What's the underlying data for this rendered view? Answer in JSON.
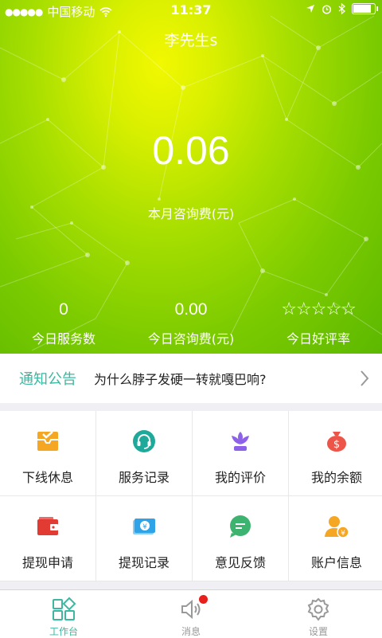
{
  "status_bar": {
    "signal": "●●●●●",
    "carrier": "中国移动",
    "time": "11:37"
  },
  "header": {
    "username": "李先生s"
  },
  "summary": {
    "amount": "0.06",
    "amount_label": "本月咨询费(元)"
  },
  "stats": [
    {
      "value": "0",
      "label": "今日服务数"
    },
    {
      "value": "0.00",
      "label": "今日咨询费(元)"
    },
    {
      "stars": "☆☆☆☆☆",
      "label": "今日好评率"
    }
  ],
  "notice": {
    "tag": "通知公告",
    "text": "为什么脖子发硬一转就嘎巴响?"
  },
  "menu": [
    {
      "label": "下线休息",
      "icon": "offline-rest-icon",
      "color": "#f5a623"
    },
    {
      "label": "服务记录",
      "icon": "headset-icon",
      "color": "#1fa99a"
    },
    {
      "label": "我的评价",
      "icon": "lotus-icon",
      "color": "#8e62e8"
    },
    {
      "label": "我的余额",
      "icon": "money-bag-icon",
      "color": "#ee5549"
    },
    {
      "label": "提现申请",
      "icon": "wallet-icon",
      "color": "#e23b33"
    },
    {
      "label": "提现记录",
      "icon": "banknote-icon",
      "color": "#2ea3e8"
    },
    {
      "label": "意见反馈",
      "icon": "chat-bubble-icon",
      "color": "#3cb36e"
    },
    {
      "label": "账户信息",
      "icon": "account-user-icon",
      "color": "#f5a623"
    }
  ],
  "tabbar": [
    {
      "label": "工作台",
      "icon": "workbench-icon",
      "active": true
    },
    {
      "label": "消息",
      "icon": "speaker-icon",
      "active": false,
      "badge": true
    },
    {
      "label": "设置",
      "icon": "gear-icon",
      "active": false
    }
  ],
  "colors": {
    "accent": "#3cb7a0",
    "hero_light": "#f2f800",
    "hero_dark": "#5cb800",
    "badge": "#e8201d"
  }
}
